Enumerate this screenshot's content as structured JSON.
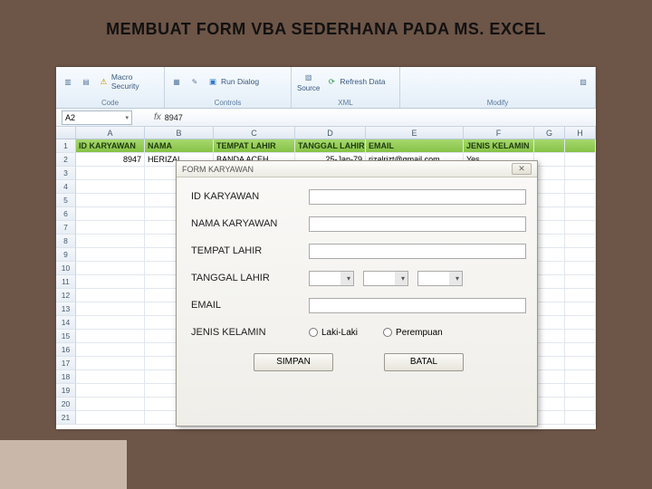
{
  "slide_title": "MEMBUAT FORM VBA SEDERHANA PADA MS. EXCEL",
  "ribbon": {
    "groups": {
      "code": {
        "label": "Code",
        "vb": "Visual\nBasic",
        "macros": "Macros",
        "security": "Macro Security"
      },
      "controls": {
        "label": "Controls",
        "insert": "Insert",
        "design": "Design\nMode",
        "run": "Run Dialog"
      },
      "xml": {
        "label": "XML",
        "source": "Source",
        "refresh": "Refresh Data"
      },
      "modify": {
        "label": "Modify",
        "docpanel": "Document\nPanel"
      }
    }
  },
  "namebox": "A2",
  "formula": "8947",
  "columns": [
    "A",
    "B",
    "C",
    "D",
    "E",
    "F",
    "G",
    "H"
  ],
  "header_row": [
    "ID KARYAWAN",
    "NAMA",
    "TEMPAT LAHIR",
    "TANGGAL LAHIR",
    "EMAIL",
    "JENIS KELAMIN",
    "",
    ""
  ],
  "data_row": [
    "8947",
    "HERIZAL",
    "BANDA ACEH",
    "25-Jan-79",
    "rizalrizt@gmail.com",
    "Yes",
    "",
    ""
  ],
  "row_count": 21,
  "dialog": {
    "title": "FORM KARYAWAN",
    "fields": {
      "id": "ID KARYAWAN",
      "nama": "NAMA KARYAWAN",
      "tempat": "TEMPAT LAHIR",
      "tanggal": "TANGGAL LAHIR",
      "email": "EMAIL",
      "jk": "JENIS KELAMIN"
    },
    "radio": {
      "male": "Laki-Laki",
      "female": "Perempuan"
    },
    "buttons": {
      "save": "SIMPAN",
      "cancel": "BATAL"
    },
    "close": "✕"
  }
}
